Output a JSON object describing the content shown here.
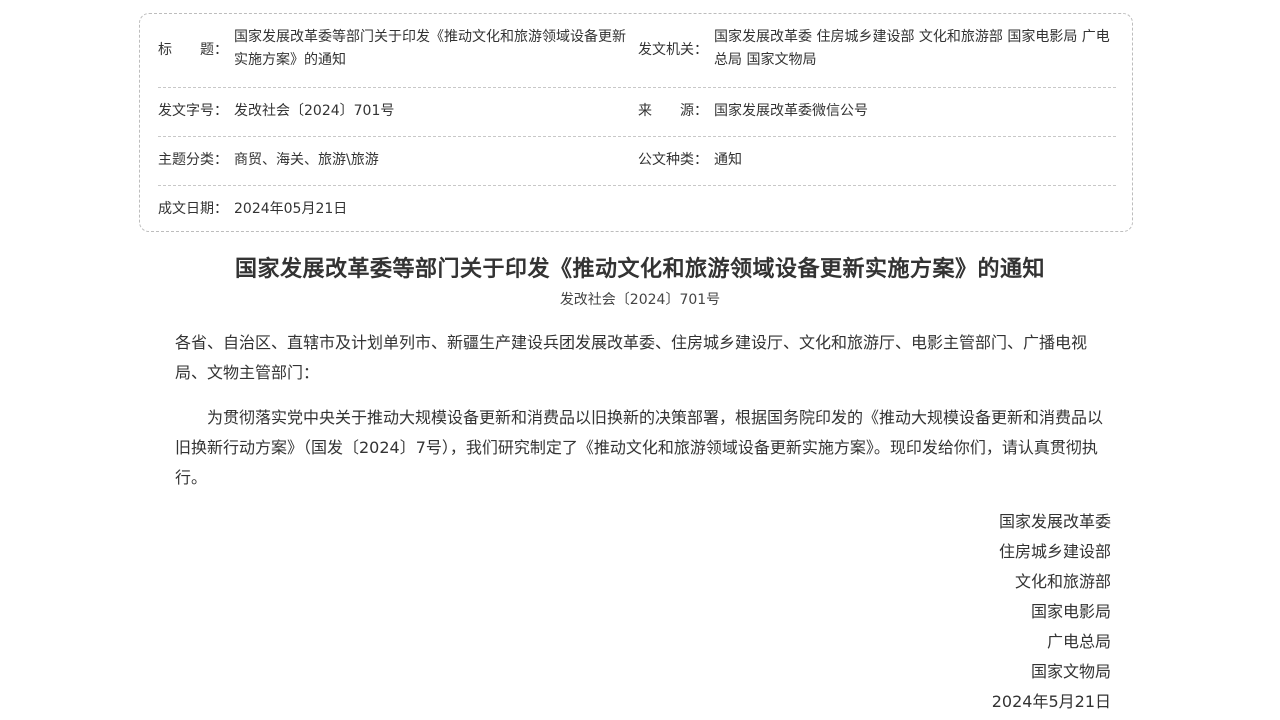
{
  "meta": {
    "rows": [
      {
        "l1": "标　　题：",
        "v1": "国家发展改革委等部门关于印发《推动文化和旅游领域设备更新实施方案》的通知",
        "l2": "发文机关：",
        "v2": "国家发展改革委 住房城乡建设部 文化和旅游部 国家电影局 广电总局 国家文物局"
      },
      {
        "l1": "发文字号：",
        "v1": "发改社会〔2024〕701号",
        "l2": "来　　源：",
        "v2": "国家发展改革委微信公号"
      },
      {
        "l1": "主题分类：",
        "v1": "商贸、海关、旅游\\旅游",
        "l2": "公文种类：",
        "v2": "通知"
      },
      {
        "l1": "成文日期：",
        "v1": "2024年05月21日"
      }
    ]
  },
  "document": {
    "title": "国家发展改革委等部门关于印发《推动文化和旅游领域设备更新实施方案》的通知",
    "number": "发改社会〔2024〕701号",
    "salutation": "各省、自治区、直辖市及计划单列市、新疆生产建设兵团发展改革委、住房城乡建设厅、文化和旅游厅、电影主管部门、广播电视局、文物主管部门：",
    "body": "为贯彻落实党中央关于推动大规模设备更新和消费品以旧换新的决策部署，根据国务院印发的《推动大规模设备更新和消费品以旧换新行动方案》（国发〔2024〕7号），我们研究制定了《推动文化和旅游领域设备更新实施方案》。现印发给你们，请认真贯彻执行。",
    "signatories": [
      "国家发展改革委",
      "住房城乡建设部",
      "文化和旅游部",
      "国家电影局",
      "广电总局",
      "国家文物局"
    ],
    "date": "2024年5月21日"
  }
}
